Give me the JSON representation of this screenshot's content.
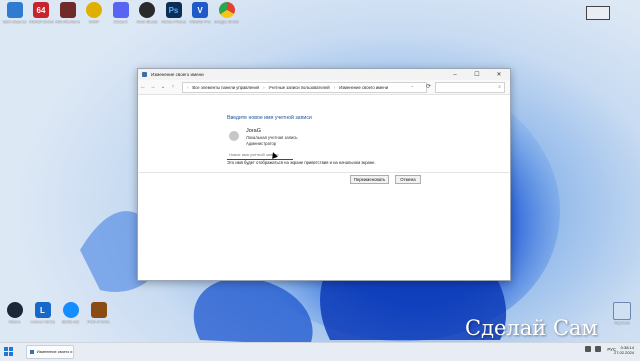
{
  "desktop": {
    "top_icons": [
      {
        "label": "Sam channel",
        "icon": "monitor-icon",
        "color": "#2f7bd1"
      },
      {
        "label": "AIDA64 Extreme",
        "icon": "aida64-icon",
        "color": "#c9242b"
      },
      {
        "label": "MSI Afterburner",
        "icon": "afterburner-icon",
        "color": "#6f2a2a"
      },
      {
        "label": "GIMP",
        "icon": "gimp-icon",
        "color": "#e0b000"
      },
      {
        "label": "Discord",
        "icon": "discord-icon",
        "color": "#5865f2"
      },
      {
        "label": "OBS Studio",
        "icon": "obs-icon",
        "color": "#2a2a2a"
      },
      {
        "label": "Adobe Photoshop",
        "icon": "photoshop-icon",
        "color": "#0c2d55"
      },
      {
        "label": "VEGAS Pro",
        "icon": "vegas-icon",
        "color": "#1e5bc6"
      },
      {
        "label": "Google Chrome",
        "icon": "chrome-icon",
        "color": "#e24132"
      }
    ],
    "top_icon_glyphs": [
      "",
      "64",
      "",
      "",
      "",
      "",
      "Ps",
      "V",
      ""
    ],
    "bottom_icons": [
      {
        "label": "Steam",
        "icon": "steam-icon",
        "color": "#1b2838"
      },
      {
        "label": "Lenovo Vantage",
        "icon": "lenovo-icon",
        "color": "#1669c9"
      },
      {
        "label": "Battle.net",
        "icon": "battlenet-icon",
        "color": "#148eff"
      },
      {
        "label": "Path of Exile",
        "icon": "poe-icon",
        "color": "#8a4b14"
      }
    ],
    "bottom_icon_glyphs": [
      "",
      "L",
      "",
      ""
    ],
    "recycle_label": "Корзина",
    "watermark": "Сделай Сам"
  },
  "window": {
    "title": "Изменение своего имени",
    "controls": {
      "minimize": "–",
      "maximize": "☐",
      "close": "✕"
    },
    "nav": {
      "back": "←",
      "forward": "→",
      "down": "⌄",
      "up": "↑"
    },
    "breadcrumb": [
      "Все элементы панели управления",
      "Учетные записи пользователей",
      "Изменение своего имени"
    ],
    "breadcrumb_sep": "›",
    "refresh": "⟳",
    "search_icon": "⌕",
    "heading": "Введите новое имя учетной записи",
    "user": {
      "name": "JoraG",
      "account_type": "Локальная учетная запись",
      "role": "Администратор"
    },
    "new_name_placeholder": "Новое имя учетной записи",
    "hint": "Это имя будет отображаться на экране приветствия и на начальном экране.",
    "buttons": {
      "rename": "Переименовать",
      "cancel": "Отмена"
    }
  },
  "taskbar": {
    "task_label": "Изменение своего и",
    "language": "РУС",
    "time": "0:38:14",
    "date": "27.02.2024"
  }
}
